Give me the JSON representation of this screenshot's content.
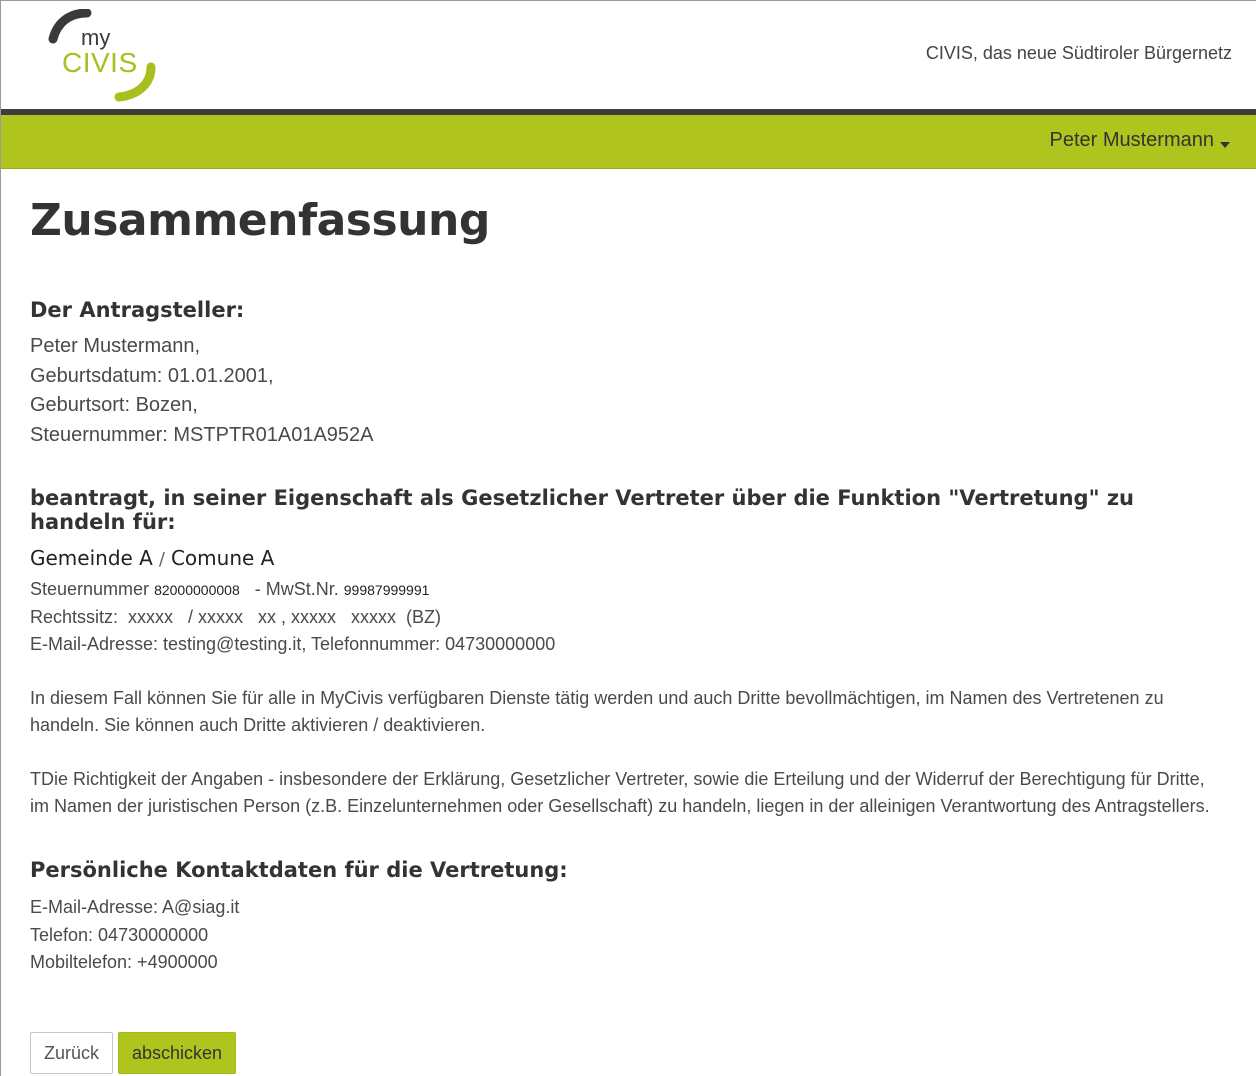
{
  "header": {
    "logo_my": "my",
    "logo_civis": "CIVIS",
    "tagline": "CIVIS, das neue Südtiroler Bürgernetz"
  },
  "user_menu": {
    "name": "Peter Mustermann"
  },
  "page": {
    "title": "Zusammenfassung"
  },
  "applicant": {
    "heading": "Der Antragsteller:",
    "name": "Peter Mustermann,",
    "birthdate": "Geburtsdatum: 01.01.2001,",
    "birthplace": "Geburtsort: Bozen,",
    "tax_number": "Steuernummer: MSTPTR01A01A952A"
  },
  "request": {
    "heading": "beantragt, in seiner Eigenschaft als Gesetzlicher Vertreter über die Funktion \"Vertretung\" zu handeln für:",
    "entity_name_de": "Gemeinde A",
    "entity_sep": "/",
    "entity_name_it": "Comune A",
    "tax_label": "Steuernummer",
    "tax_value": "82000000008",
    "vat_label": "- MwSt.Nr.",
    "vat_value": "99987999991",
    "seat": "Rechtssitz:  xxxxx   / xxxxx   xx , xxxxx   xxxxx  (BZ)",
    "contact": "E-Mail-Adresse: testing@testing.it, Telefonnummer: 04730000000"
  },
  "info": {
    "paragraph1": "In diesem Fall können Sie für alle in MyCivis verfügbaren Dienste tätig werden und auch Dritte bevollmächtigen, im Namen des Vertretenen zu handeln. Sie können auch Dritte aktivieren / deaktivieren.",
    "paragraph2": "TDie Richtigkeit der Angaben - insbesondere der Erklärung, Gesetzlicher Vertreter, sowie die Erteilung und der Widerruf der Berechtigung für Dritte, im Namen der juristischen Person (z.B. Einzelunternehmen oder Gesellschaft) zu handeln, liegen in der alleinigen Verantwortung des Antragstellers."
  },
  "personal_contact": {
    "heading": "Persönliche Kontaktdaten für die Vertretung:",
    "email": "E-Mail-Adresse: A@siag.it",
    "phone": "Telefon: 04730000000",
    "mobile": "Mobiltelefon: +4900000"
  },
  "actions": {
    "back_label": "Zurück",
    "submit_label": "abschicken"
  },
  "colors": {
    "brand_green": "#b0c41e",
    "dark_rule": "#3d3d3d",
    "text": "#333333"
  }
}
